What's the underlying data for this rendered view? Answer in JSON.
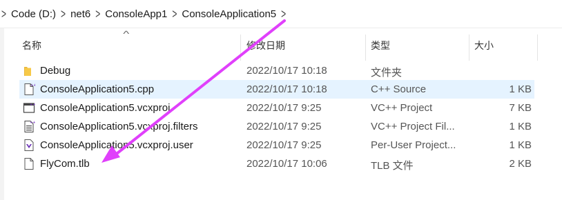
{
  "breadcrumb": [
    "Code (D:)",
    "net6",
    "ConsoleApp1",
    "ConsoleApplication5"
  ],
  "columns": {
    "name": "名称",
    "date": "修改日期",
    "type": "类型",
    "size": "大小"
  },
  "files": [
    {
      "name": "Debug",
      "date": "2022/10/17 10:18",
      "type": "文件夹",
      "size": "",
      "icon": "folder-icon",
      "selected": false
    },
    {
      "name": "ConsoleApplication5.cpp",
      "date": "2022/10/17 10:18",
      "type": "C++ Source",
      "size": "1 KB",
      "icon": "cpp-file-icon",
      "selected": true
    },
    {
      "name": "ConsoleApplication5.vcxproj",
      "date": "2022/10/17 9:25",
      "type": "VC++ Project",
      "size": "7 KB",
      "icon": "vcxproj-file-icon",
      "selected": false
    },
    {
      "name": "ConsoleApplication5.vcxproj.filters",
      "date": "2022/10/17 9:25",
      "type": "VC++ Project Fil...",
      "size": "1 KB",
      "icon": "filters-file-icon",
      "selected": false
    },
    {
      "name": "ConsoleApplication5.vcxproj.user",
      "date": "2022/10/17 9:25",
      "type": "Per-User Project...",
      "size": "1 KB",
      "icon": "user-file-icon",
      "selected": false
    },
    {
      "name": "FlyCom.tlb",
      "date": "2022/10/17 10:06",
      "type": "TLB 文件",
      "size": "2 KB",
      "icon": "tlb-file-icon",
      "selected": false
    }
  ],
  "colors": {
    "selection": "#e5f3ff",
    "annotation_arrow": "#e040fb",
    "folder": "#f7c948"
  }
}
